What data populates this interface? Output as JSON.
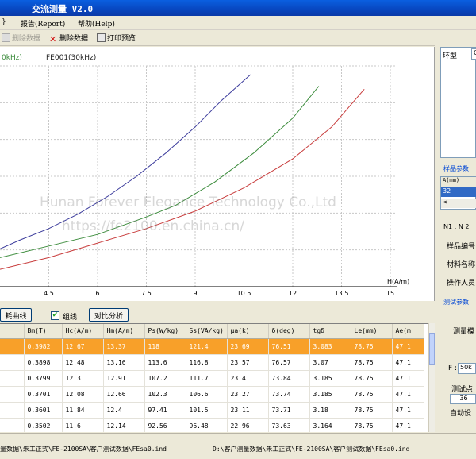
{
  "window": {
    "title": "交流测量 V2.0"
  },
  "menu": {
    "items": [
      "}",
      "报告(Report)",
      "帮助(Help)"
    ]
  },
  "toolbar": {
    "btn_add": "删除数据",
    "btn_delete": "删除数据",
    "btn_print": "打印预览"
  },
  "chart_data": {
    "type": "line",
    "legend": [
      "0kHz)",
      "FE001(30kHz)"
    ],
    "xlabel": "H(A/m)",
    "xticks": [
      "4.5",
      "6",
      "7.5",
      "9",
      "10.5",
      "12",
      "13.5",
      "15"
    ],
    "xlim": [
      3.0,
      15.8
    ],
    "grid": true,
    "series": [
      {
        "color": "#3c3c9c",
        "x": [
          3.0,
          3.6,
          4.5,
          5.4,
          6.3,
          7.2,
          8.1,
          9.0,
          9.8,
          10.7
        ],
        "y": [
          0.345,
          0.36,
          0.38,
          0.405,
          0.435,
          0.47,
          0.51,
          0.555,
          0.6,
          0.645
        ]
      },
      {
        "color": "#3c8c3c",
        "x": [
          3.0,
          4.5,
          6.0,
          7.5,
          8.4,
          9.6,
          10.8,
          12.0,
          12.8
        ],
        "y": [
          0.33,
          0.35,
          0.37,
          0.4,
          0.42,
          0.46,
          0.51,
          0.57,
          0.625
        ]
      },
      {
        "color": "#c83c3c",
        "x": [
          3.0,
          4.5,
          6.0,
          7.5,
          9.0,
          10.5,
          12.0,
          13.2,
          14.2
        ],
        "y": [
          0.31,
          0.33,
          0.355,
          0.38,
          0.41,
          0.45,
          0.5,
          0.555,
          0.62
        ]
      }
    ]
  },
  "controls": {
    "btn_loss": "耗曲线",
    "chk_group": "组线",
    "btn_compare": "对比分析"
  },
  "table": {
    "columns": [
      "",
      "Bm(T)",
      "Hc(A/m)",
      "Hm(A/m)",
      "Ps(W/kg)",
      "Ss(VA/kg)",
      "μa(k)",
      "δ(deg)",
      "tgδ",
      "Le(mm)",
      "Ae(m"
    ],
    "rows": [
      [
        "",
        "0.3982",
        "12.67",
        "13.37",
        "118",
        "121.4",
        "23.69",
        "76.51",
        "3.083",
        "78.75",
        "47.1"
      ],
      [
        "",
        "0.3898",
        "12.48",
        "13.16",
        "113.6",
        "116.8",
        "23.57",
        "76.57",
        "3.07",
        "78.75",
        "47.1"
      ],
      [
        "",
        "0.3799",
        "12.3",
        "12.91",
        "107.2",
        "111.7",
        "23.41",
        "73.84",
        "3.185",
        "78.75",
        "47.1"
      ],
      [
        "",
        "0.3701",
        "12.08",
        "12.66",
        "102.3",
        "106.6",
        "23.27",
        "73.74",
        "3.185",
        "78.75",
        "47.1"
      ],
      [
        "",
        "0.3601",
        "11.84",
        "12.4",
        "97.41",
        "101.5",
        "23.11",
        "73.71",
        "3.18",
        "78.75",
        "47.1"
      ],
      [
        "",
        "0.3502",
        "11.6",
        "12.14",
        "92.56",
        "96.48",
        "22.96",
        "73.63",
        "3.164",
        "78.75",
        "47.1"
      ]
    ]
  },
  "status": {
    "left": "量数据\\朱工正式\\FE-2100SA\\客户测试数据\\FEsa0.ind",
    "right": "D:\\客户测量数据\\朱工正式\\FE-2100SA\\客户测试数据\\FEsa0.ind"
  },
  "right_panel": {
    "ring_label": "环型",
    "ring_value": "C",
    "sample_group": "样品参数",
    "a_col": "A(mm)",
    "a_value": "32",
    "n_label": "N1 : N 2",
    "sample_no": "样品编号",
    "material": "材料名称",
    "operator": "操作人员",
    "test_group": "测试参数",
    "mode_label": "测量模",
    "f_label": "F :",
    "f_value": "50k",
    "points_label": "测试点",
    "points_value": "36",
    "auto_label": "自动设"
  },
  "watermark": {
    "line1": "Hunan Forever Elegance Technology Co.,Ltd",
    "line2": "https://fe2100.en.china.cn/"
  }
}
